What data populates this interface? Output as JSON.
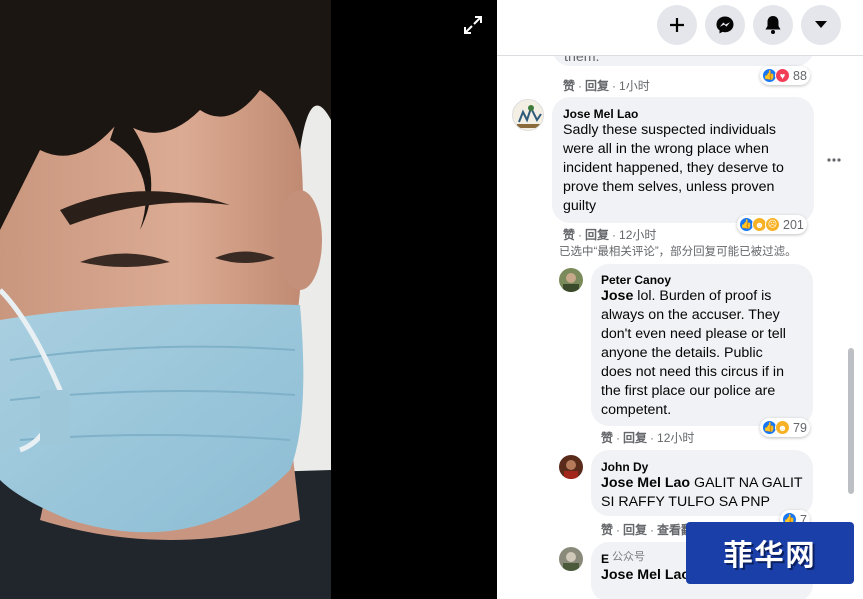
{
  "comments": [
    {
      "text_tail": "them.",
      "like_label": "赞",
      "reply_label": "回复",
      "time": "1小时",
      "reaction_count": "88"
    },
    {
      "author": "Jose Mel Lao",
      "lines": [
        "Sadly these suspected individuals",
        "were all in the wrong place when",
        "incident happened, they deserve to",
        "prove them selves, unless proven",
        "guilty"
      ],
      "like_label": "赞",
      "reply_label": "回复",
      "time": "12小时",
      "reaction_count": "201"
    }
  ],
  "filter_note": "已选中“最相关评论”，部分回复可能已被过滤。",
  "replies": [
    {
      "author": "Peter Canoy",
      "tag": "Jose",
      "first_line_rest": " lol. Burden of proof is",
      "lines": [
        "always on the accuser. They",
        "don't even need please or tell",
        "anyone the details. Public",
        "does not need this circus if in",
        "the first place our police are",
        "competent."
      ],
      "like_label": "赞",
      "reply_label": "回复",
      "time": "12小时",
      "reaction_count": "79"
    },
    {
      "author": "John Dy",
      "tag": "Jose Mel Lao",
      "first_line_rest": " GALIT NA GALIT",
      "lines": [
        "SI RAFFY TULFO SA PNP"
      ],
      "like_label": "赞",
      "reply_label": "回复",
      "more_label": "查看翻",
      "reaction_count": "7"
    },
    {
      "author_partial": "E",
      "tag": "Jose Mel Lao",
      "tail": "r"
    }
  ],
  "watermark": "菲华网",
  "watermark_left": "公众号",
  "icons": {
    "expand": "expand-icon",
    "plus": "plus-icon",
    "messenger": "messenger-icon",
    "bell": "bell-icon",
    "dropdown": "caret-down-icon",
    "more": "more-options-icon"
  },
  "colors": {
    "like": "#1877f2",
    "love": "#f33e58",
    "haha": "#f7b125",
    "bubble": "#f0f2f5",
    "meta": "#65676b"
  }
}
